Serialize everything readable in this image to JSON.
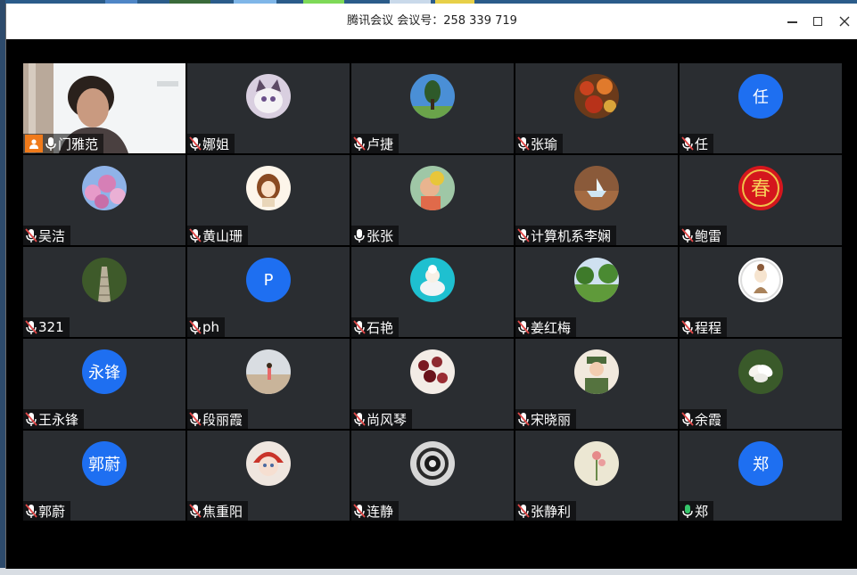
{
  "window": {
    "title": "腾讯会议 会议号：258 339 719",
    "buttons": {
      "minimize": "minimize",
      "maximize": "maximize",
      "close": "close"
    }
  },
  "colors": {
    "accent": "#1e6ff1",
    "host_badge": "#f07a1a",
    "mic_muted": "#e04848",
    "mic_active": "#35c66b",
    "active_border": "#35c66b"
  },
  "participants": [
    {
      "name": "门雅范",
      "avatar": "video",
      "mic": "on",
      "host": true,
      "icon": "user-icon"
    },
    {
      "name": "娜姐",
      "avatar": "cat-photo",
      "mic": "muted"
    },
    {
      "name": "卢捷",
      "avatar": "tree-photo",
      "mic": "muted"
    },
    {
      "name": "张瑜",
      "avatar": "autumn-leaves-photo",
      "mic": "muted"
    },
    {
      "name": "任",
      "avatar": "initial",
      "avatar_text": "任",
      "mic": "muted"
    },
    {
      "name": "吴洁",
      "avatar": "blossom-photo",
      "mic": "muted"
    },
    {
      "name": "黄山珊",
      "avatar": "cartoon-girl",
      "mic": "muted"
    },
    {
      "name": "张张",
      "avatar": "child-photo",
      "mic": "on"
    },
    {
      "name": "计算机系李娴",
      "avatar": "paper-boat-photo",
      "mic": "muted"
    },
    {
      "name": "鲍雷",
      "avatar": "spring-character",
      "mic": "muted"
    },
    {
      "name": "321",
      "avatar": "stairs-photo",
      "mic": "muted"
    },
    {
      "name": "ph",
      "avatar": "initial",
      "avatar_text": "P",
      "mic": "muted"
    },
    {
      "name": "石艳",
      "avatar": "teacup-photo",
      "mic": "muted"
    },
    {
      "name": "姜红梅",
      "avatar": "park-photo",
      "mic": "muted"
    },
    {
      "name": "程程",
      "avatar": "cartoon-figure",
      "mic": "muted"
    },
    {
      "name": "王永锋",
      "avatar": "initial",
      "avatar_text": "永锋",
      "mic": "muted"
    },
    {
      "name": "段丽霞",
      "avatar": "beach-photo",
      "mic": "muted"
    },
    {
      "name": "尚风琴",
      "avatar": "berries-photo",
      "mic": "muted"
    },
    {
      "name": "宋晓丽",
      "avatar": "uniform-portrait",
      "mic": "muted"
    },
    {
      "name": "余霞",
      "avatar": "magnolia-photo",
      "mic": "muted"
    },
    {
      "name": "郭蔚",
      "avatar": "initial",
      "avatar_text": "郭蔚",
      "mic": "muted"
    },
    {
      "name": "焦重阳",
      "avatar": "doll-photo",
      "mic": "muted"
    },
    {
      "name": "连静",
      "avatar": "nest-photo",
      "mic": "muted"
    },
    {
      "name": "张静利",
      "avatar": "flower-painting",
      "mic": "muted"
    },
    {
      "name": "郑",
      "avatar": "initial",
      "avatar_text": "郑",
      "mic": "active"
    }
  ]
}
